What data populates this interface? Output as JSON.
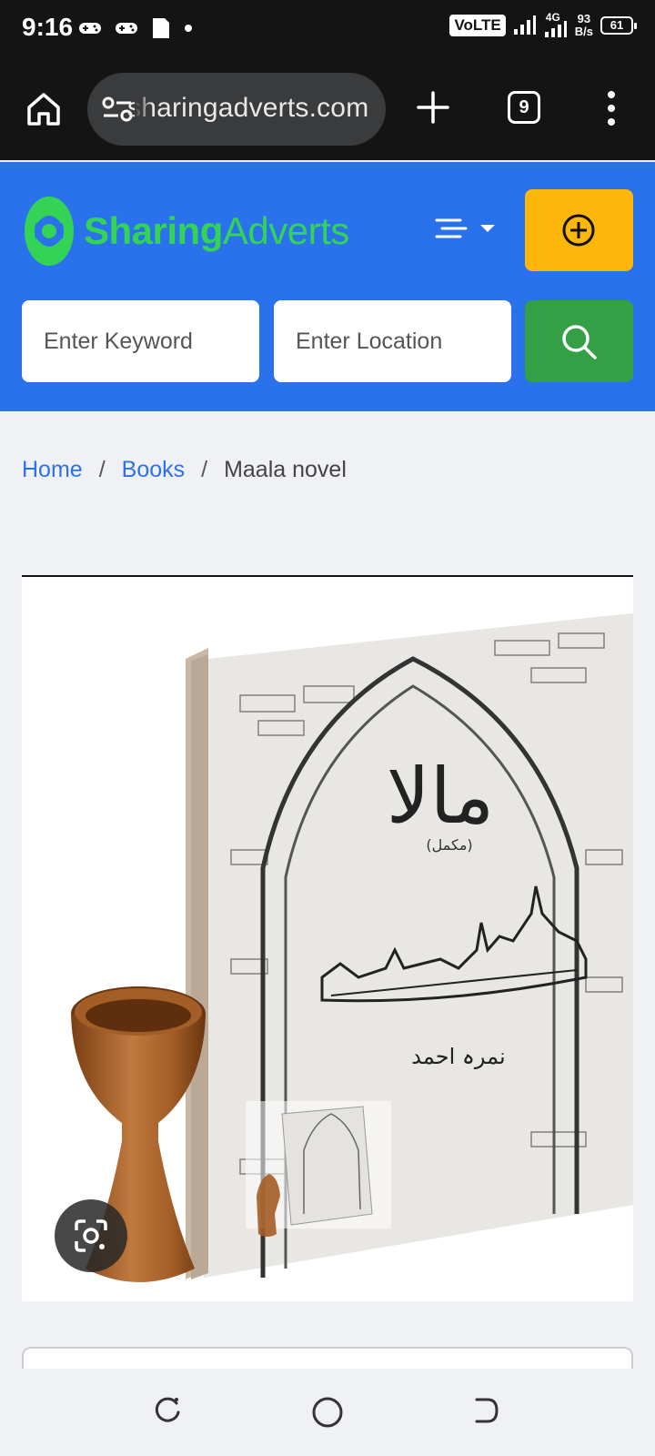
{
  "status_bar": {
    "time": "9:16",
    "network": "VoLTE",
    "signal_label": "4G",
    "speed_value": "93",
    "speed_unit": "B/s",
    "battery": "61",
    "icons": [
      "gamepad-icon",
      "gamepad-icon",
      "file-icon",
      "dot-icon",
      "signal-icon",
      "battery-icon"
    ]
  },
  "browser": {
    "url": "sharingadverts.com",
    "tab_count": "9",
    "icons": [
      "home-icon",
      "site-settings-icon",
      "new-tab-icon",
      "tabs-icon",
      "menu-icon"
    ]
  },
  "header": {
    "logo_part1": "Sharing",
    "logo_part2": "Adverts",
    "brand_color": "#2a72ec",
    "logo_color": "#33d455",
    "post_button_color": "#fdb70a",
    "search_button_color": "#34a045",
    "keyword_placeholder": "Enter Keyword",
    "location_placeholder": "Enter Location"
  },
  "breadcrumb": {
    "home": "Home",
    "category": "Books",
    "current": "Maala novel",
    "separator": "/"
  },
  "product": {
    "image_title_urdu": "مالا",
    "image_subtitle_urdu": "(مکمل)",
    "image_author_urdu": "نمرہ احمد"
  },
  "navbar": {
    "icons": [
      "recents-icon",
      "home-circle-icon",
      "back-icon"
    ]
  }
}
